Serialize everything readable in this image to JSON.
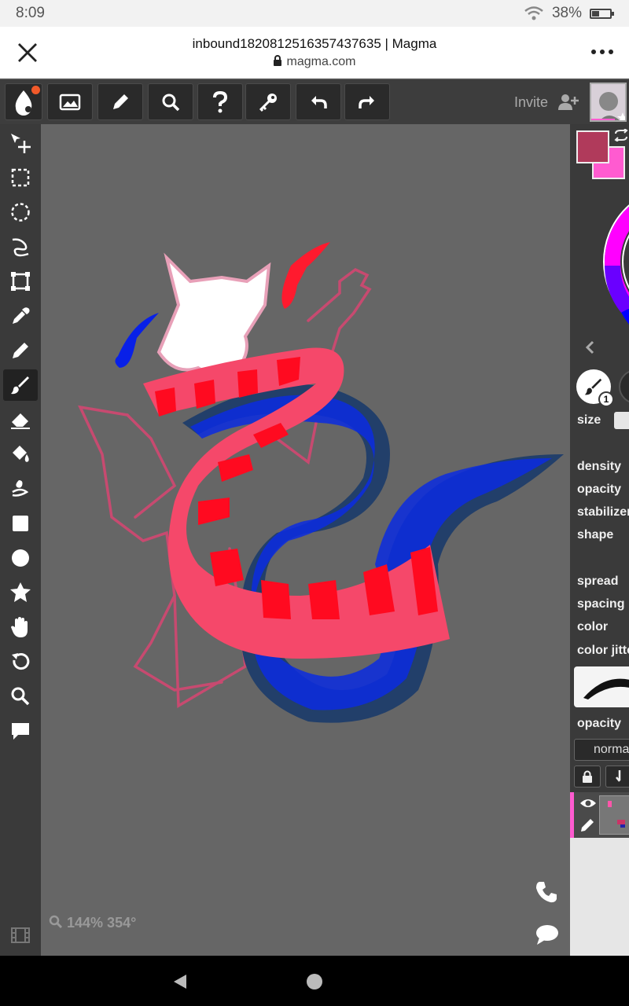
{
  "status": {
    "time": "8:09",
    "battery": "38%",
    "battery_level": 0.38
  },
  "browser": {
    "title": "inbound1820812516357437635 | Magma",
    "url": "magma.com"
  },
  "toolbar": {
    "invite_label": "Invite"
  },
  "canvas": {
    "zoom_info": "144% 354°"
  },
  "colors": {
    "primary": "#b03a5b",
    "secondary": "#ff5bd0",
    "accent": "#f25a2a"
  },
  "brush": {
    "size_badge": "1"
  },
  "panel": {
    "size_label": "size",
    "settings": [
      "density",
      "opacity",
      "stabilizer",
      "shape",
      "spread",
      "spacing",
      "color",
      "color jitter"
    ],
    "layer_opacity_label": "opacity",
    "blend_mode": "normal"
  },
  "icons": {
    "left_tools": [
      "move-icon",
      "rect-select-icon",
      "ellipse-select-icon",
      "lasso-icon",
      "transform-icon",
      "eyedropper-icon",
      "pencil-icon",
      "brush-icon",
      "eraser-icon",
      "fill-icon",
      "smudge-icon",
      "rectangle-icon",
      "circle-icon",
      "shape-icon",
      "hand-icon",
      "rotate-icon",
      "zoom-icon",
      "comment-icon"
    ]
  }
}
